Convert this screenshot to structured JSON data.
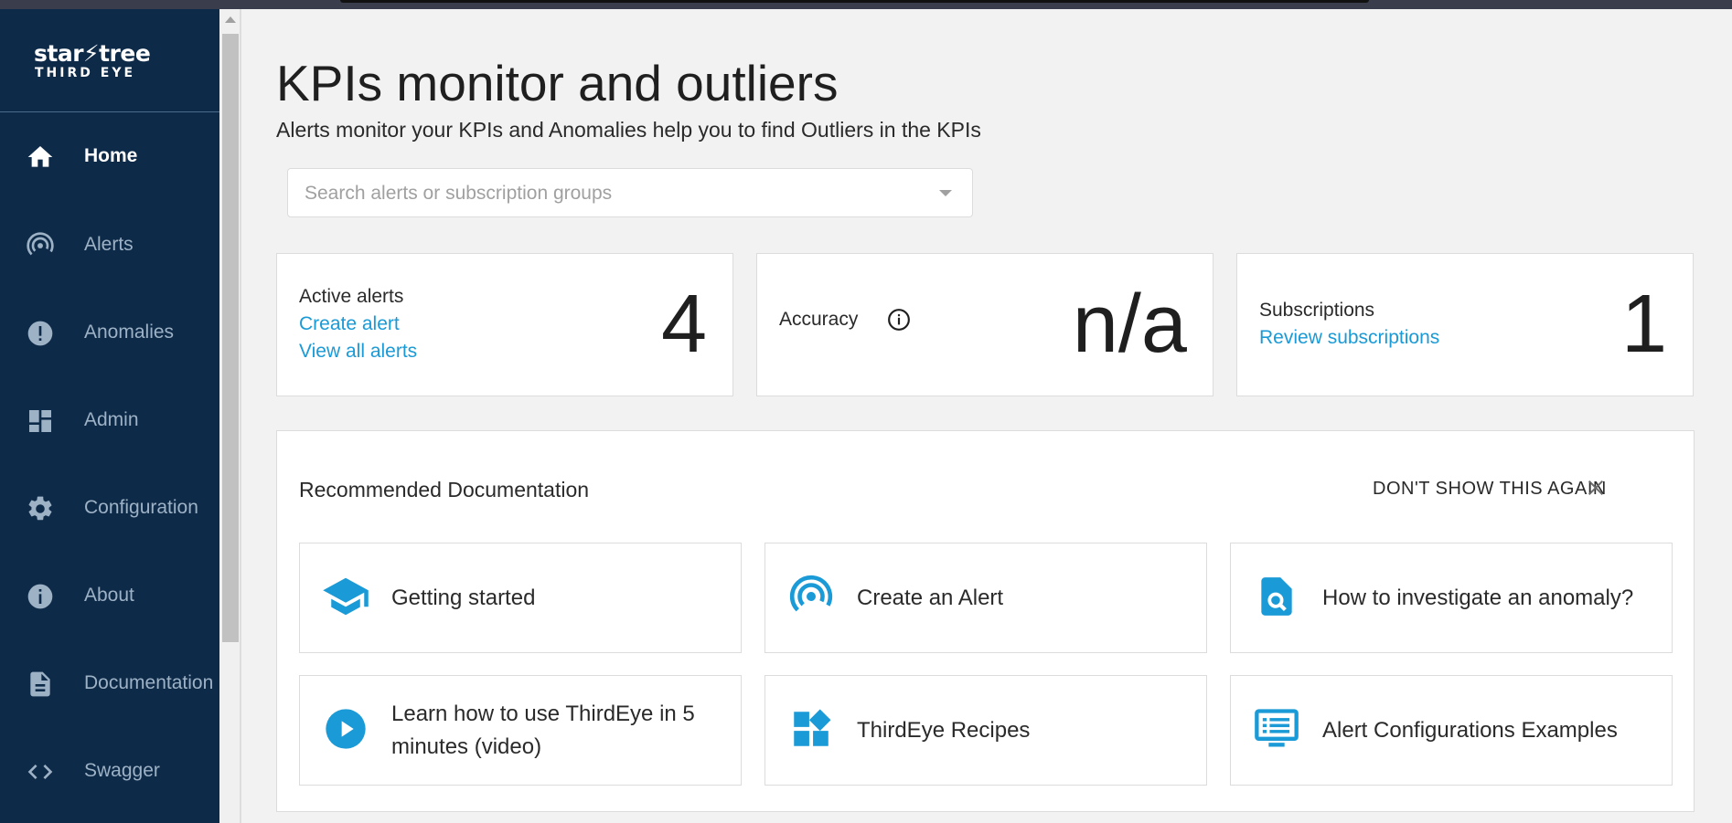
{
  "logo": {
    "top": "star⚡tree",
    "bottom": "THIRD EYE"
  },
  "sidebar": {
    "items": [
      {
        "label": "Home",
        "icon": "home-icon",
        "active": true
      },
      {
        "label": "Alerts",
        "icon": "alerts-icon"
      },
      {
        "label": "Anomalies",
        "icon": "anomalies-icon"
      },
      {
        "label": "Admin",
        "icon": "admin-icon"
      },
      {
        "label": "Configuration",
        "icon": "gear-icon"
      },
      {
        "label": "About",
        "icon": "info-icon"
      },
      {
        "label": "Documentation",
        "icon": "document-icon"
      },
      {
        "label": "Swagger",
        "icon": "code-icon"
      }
    ]
  },
  "header": {
    "title": "KPIs monitor and outliers",
    "subtitle": "Alerts monitor your KPIs and Anomalies help you to find Outliers in the KPIs"
  },
  "search": {
    "placeholder": "Search alerts or subscription groups",
    "value": ""
  },
  "stats": {
    "active_alerts": {
      "label": "Active alerts",
      "links": [
        "Create alert",
        "View all alerts"
      ],
      "value": "4"
    },
    "accuracy": {
      "label": "Accuracy",
      "value": "n/a",
      "icon": "info-icon"
    },
    "subscriptions": {
      "label": "Subscriptions",
      "links": [
        "Review subscriptions"
      ],
      "value": "1"
    }
  },
  "docs": {
    "title": "Recommended Documentation",
    "dismiss_label": "DON'T SHOW THIS AGAIN",
    "accent_color": "#1a9ad6",
    "cards": [
      {
        "label": "Getting started",
        "icon": "graduation-cap-icon"
      },
      {
        "label": "Create an Alert",
        "icon": "alert-broadcast-icon"
      },
      {
        "label": "How to investigate an anomaly?",
        "icon": "document-search-icon"
      },
      {
        "label": "Learn how to use ThirdEye in 5 minutes (video)",
        "icon": "play-circle-icon"
      },
      {
        "label": "ThirdEye Recipes",
        "icon": "widgets-icon"
      },
      {
        "label": "Alert Configurations Examples",
        "icon": "monitor-list-icon"
      }
    ]
  }
}
